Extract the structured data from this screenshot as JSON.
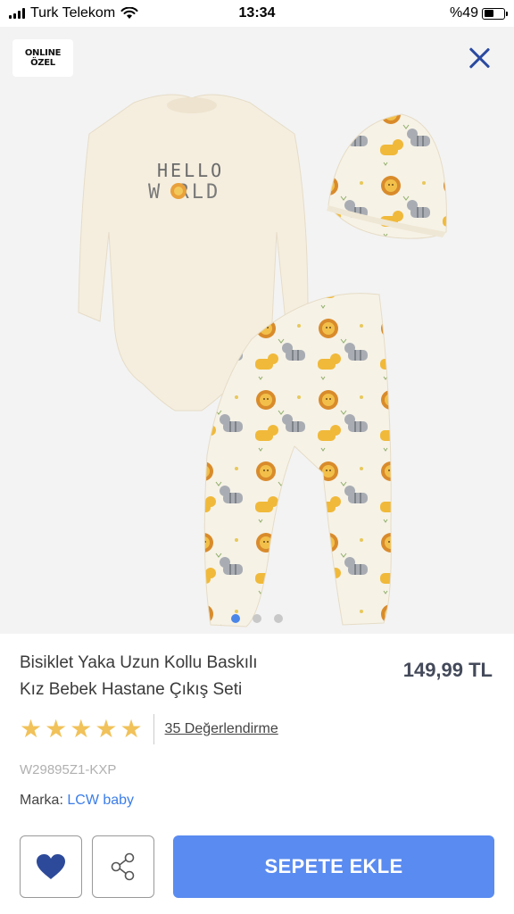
{
  "status_bar": {
    "carrier": "Turk Telekom",
    "time": "13:34",
    "battery_text": "%49",
    "battery_level": 0.49
  },
  "image": {
    "badge_line1": "ONLINE",
    "badge_line2": "ÖZEL",
    "print_line1": "HELLO",
    "print_line2": "W RLD",
    "carousel": {
      "count": 3,
      "active_index": 0
    }
  },
  "product": {
    "title_line1": "Bisiklet Yaka Uzun Kollu Baskılı",
    "title_line2": "Kız Bebek Hastane Çıkış Seti",
    "price": "149,99 TL",
    "rating_stars": 5,
    "reviews": "35 Değerlendirme",
    "sku": "W29895Z1-KXP",
    "brand_label": "Marka:",
    "brand_name": "LCW baby"
  },
  "actions": {
    "add_to_cart": "SEPETE EKLE",
    "favorite_icon": "heart-icon",
    "share_icon": "share-icon"
  },
  "colors": {
    "accent": "#5a8bf0",
    "close": "#2b4aa0",
    "star": "#f1c25a",
    "heart": "#2d4a9a"
  }
}
